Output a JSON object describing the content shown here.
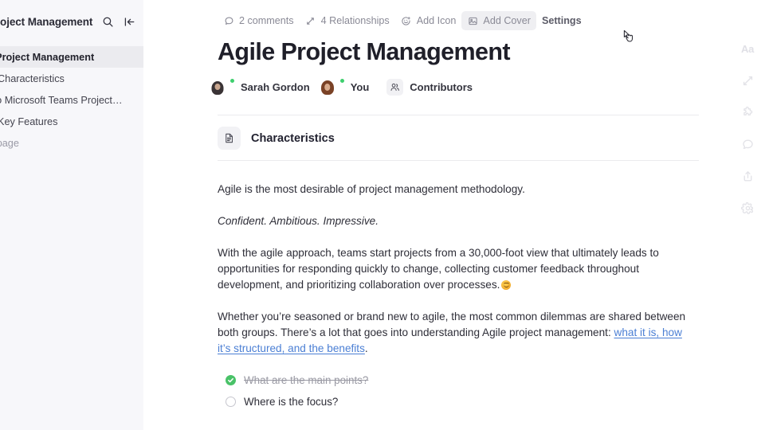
{
  "sidebar": {
    "header": {
      "title": "Project Management",
      "search_icon": "search-icon",
      "collapse_icon": "collapse-sidebar-icon"
    },
    "items": [
      {
        "label": "le Project Management",
        "selected": true
      },
      {
        "label": "Characteristics",
        "selected": false
      },
      {
        "label": "de to Microsoft Teams Project…",
        "selected": false
      },
      {
        "label": "Key Features",
        "selected": false
      },
      {
        "label": "w page",
        "selected": false,
        "muted": true
      }
    ]
  },
  "toolbar": {
    "comments": "2 comments",
    "relationships": "4 Relationships",
    "add_icon": "Add Icon",
    "add_cover": "Add Cover",
    "settings": "Settings",
    "hovered": "Add Cover"
  },
  "page": {
    "title": "Agile Project Management"
  },
  "authors": [
    {
      "name": "Sarah Gordon",
      "online": true
    },
    {
      "name": "You",
      "online": true
    }
  ],
  "contributors": {
    "label": "Contributors",
    "icon": "people-group-icon"
  },
  "doc_reference": {
    "label": "Characteristics",
    "icon": "document-icon"
  },
  "body": {
    "p1": "Agile is the most desirable of project management methodology.",
    "p2": "Confident. Ambitious. Impressive.",
    "p3": "With the agile approach, teams start projects from a 30,000-foot view that ultimately leads to opportunities for responding quickly to change, collecting customer feedback throughout development, and prioritizing collaboration over processes.",
    "p3_emoji": "😊",
    "p4_before": "Whether you’re seasoned or brand new to agile, the most common dilemmas are shared between both groups. There’s a lot that goes into understanding Agile project management: ",
    "p4_link": "what it is, how it’s structured, and the benefits",
    "p4_after": "."
  },
  "checklist": [
    {
      "label": "What are the main points?",
      "checked": true
    },
    {
      "label": "Where is the focus?",
      "checked": false
    }
  ],
  "rail": {
    "typography": "Aa",
    "items": [
      "typography-icon",
      "relationships-icon",
      "puzzle-piece-icon",
      "comment-icon",
      "share-icon",
      "gear-icon"
    ]
  },
  "colors": {
    "accent_link": "#4b7fd4",
    "status_online": "#3ecf6e",
    "checkbox_done": "#49c268",
    "sidebar_bg": "#f7f7fa",
    "sidebar_selected": "#ebebef"
  }
}
